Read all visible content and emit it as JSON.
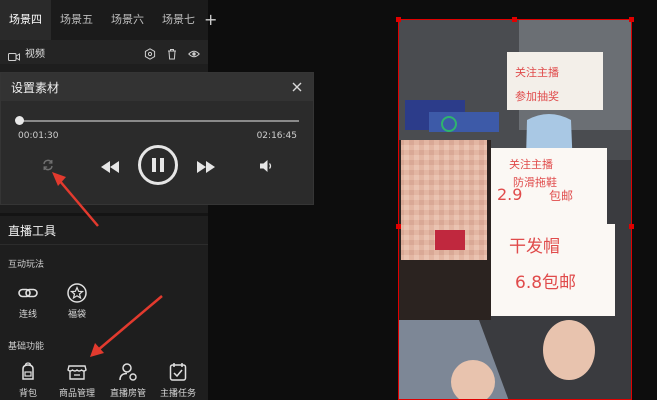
{
  "scene_tabs": [
    "场景四",
    "场景五",
    "场景六",
    "场景七"
  ],
  "active_tab_index": 0,
  "add_tab_symbol": "+",
  "layer": {
    "label": "视频"
  },
  "dialog": {
    "title": "设置素材",
    "current_time": "00:01:30",
    "total_time": "02:16:45",
    "progress": 0.0
  },
  "tools": {
    "title": "直播工具",
    "section_interactive": "互动玩法",
    "interactive_items": [
      {
        "label": "连线",
        "icon": "link-icon"
      },
      {
        "label": "福袋",
        "icon": "lucky-bag-icon"
      }
    ],
    "section_basic": "基础功能",
    "basic_items": [
      {
        "label": "背包",
        "icon": "backpack-icon"
      },
      {
        "label": "商品管理",
        "icon": "store-icon"
      },
      {
        "label": "直播房管",
        "icon": "room-admin-icon"
      },
      {
        "label": "主播任务",
        "icon": "task-icon"
      }
    ]
  },
  "preview": {
    "sign_top": "关注主播 参加抽奖",
    "sign_mid": "关注主播 防滑拖鞋 2.9 包邮",
    "sign_bottom": "干发帽 6.8包邮"
  },
  "colors": {
    "selection": "#e00000",
    "annotation_arrow": "#e23a2e",
    "panel_bg": "#1e1e1e",
    "dialog_bg": "#2b2b2b"
  }
}
